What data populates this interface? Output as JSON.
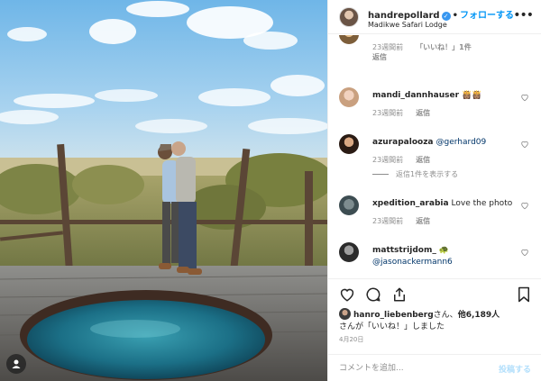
{
  "post": {
    "username": "handrepollard",
    "follow_label": "フォローする",
    "location": "Madikwe Safari Lodge",
    "more_icon": "more-horizontal-icon"
  },
  "comments": [
    {
      "time": "23週間前",
      "likes": "「いいね！」1件",
      "reply": "返信"
    },
    {
      "username": "mandi_dannhauser",
      "text": "👸🏽👸🏽",
      "time": "23週間前",
      "reply": "返信"
    },
    {
      "username": "azurapalooza",
      "text": "@gerhard09",
      "time": "23週間前",
      "reply": "返信",
      "view_replies": "返信1件を表示する"
    },
    {
      "username": "xpedition_arabia",
      "text": "Love the photo",
      "time": "23週間前",
      "reply": "返信"
    },
    {
      "username": "mattstrijdom_",
      "text": "🐢",
      "mention": "@jasonackermann6"
    }
  ],
  "likes": {
    "user": "hanro_liebenberg",
    "text1": "さん、",
    "count": "他6,189人",
    "text2": "さんが「いいね！」しました"
  },
  "date": "4月20日",
  "composer": {
    "placeholder": "コメントを追加...",
    "post_label": "投稿する"
  },
  "colors": {
    "accent": "#0095f6",
    "verified": "#3897f0",
    "muted": "#8e8e8e",
    "post_disabled": "#b2dffc"
  }
}
